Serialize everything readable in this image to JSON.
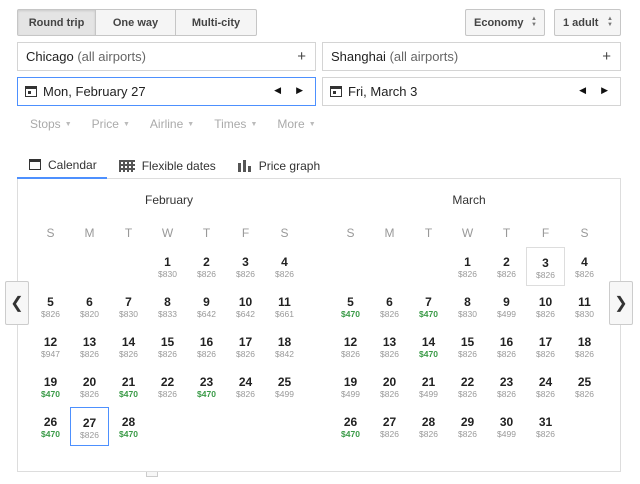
{
  "trip_type": {
    "options": [
      {
        "label": "Round trip",
        "active": true
      },
      {
        "label": "One way",
        "active": false
      },
      {
        "label": "Multi-city",
        "active": false
      }
    ]
  },
  "cabin": {
    "value": "Economy"
  },
  "passengers": {
    "value": "1 adult"
  },
  "origin": {
    "city": "Chicago",
    "qualifier": "(all airports)"
  },
  "destination": {
    "city": "Shanghai",
    "qualifier": "(all airports)"
  },
  "depart_date": {
    "value": "Mon, February 27"
  },
  "return_date": {
    "value": "Fri, March 3"
  },
  "filters": [
    "Stops",
    "Price",
    "Airline",
    "Times",
    "More"
  ],
  "view_tabs": [
    {
      "label": "Calendar",
      "icon": "calendar-icon",
      "active": true
    },
    {
      "label": "Flexible dates",
      "icon": "grid-icon",
      "active": false
    },
    {
      "label": "Price graph",
      "icon": "bar-chart-icon",
      "active": false
    }
  ],
  "weekdays": [
    "S",
    "M",
    "T",
    "W",
    "T",
    "F",
    "S"
  ],
  "colors": {
    "accent": "#4d90fe",
    "cheap": "#3b9b48",
    "muted": "#999999"
  },
  "months": [
    {
      "name": "February",
      "first_weekday": 3,
      "days": [
        {
          "d": "1",
          "p": "$830"
        },
        {
          "d": "2",
          "p": "$826"
        },
        {
          "d": "3",
          "p": "$826"
        },
        {
          "d": "4",
          "p": "$826"
        },
        {
          "d": "5",
          "p": "$826"
        },
        {
          "d": "6",
          "p": "$820"
        },
        {
          "d": "7",
          "p": "$830"
        },
        {
          "d": "8",
          "p": "$833"
        },
        {
          "d": "9",
          "p": "$642"
        },
        {
          "d": "10",
          "p": "$642"
        },
        {
          "d": "11",
          "p": "$661"
        },
        {
          "d": "12",
          "p": "$947"
        },
        {
          "d": "13",
          "p": "$826"
        },
        {
          "d": "14",
          "p": "$826"
        },
        {
          "d": "15",
          "p": "$826"
        },
        {
          "d": "16",
          "p": "$826"
        },
        {
          "d": "17",
          "p": "$826"
        },
        {
          "d": "18",
          "p": "$842"
        },
        {
          "d": "19",
          "p": "$470",
          "cheap": true
        },
        {
          "d": "20",
          "p": "$826"
        },
        {
          "d": "21",
          "p": "$470",
          "cheap": true
        },
        {
          "d": "22",
          "p": "$826"
        },
        {
          "d": "23",
          "p": "$470",
          "cheap": true
        },
        {
          "d": "24",
          "p": "$826"
        },
        {
          "d": "25",
          "p": "$499"
        },
        {
          "d": "26",
          "p": "$470",
          "cheap": true
        },
        {
          "d": "27",
          "p": "$826",
          "selected": true
        },
        {
          "d": "28",
          "p": "$470",
          "cheap": true
        }
      ]
    },
    {
      "name": "March",
      "first_weekday": 3,
      "days": [
        {
          "d": "1",
          "p": "$826"
        },
        {
          "d": "2",
          "p": "$826"
        },
        {
          "d": "3",
          "p": "$826",
          "return": true
        },
        {
          "d": "4",
          "p": "$826"
        },
        {
          "d": "5",
          "p": "$470",
          "cheap": true
        },
        {
          "d": "6",
          "p": "$826"
        },
        {
          "d": "7",
          "p": "$470",
          "cheap": true
        },
        {
          "d": "8",
          "p": "$830"
        },
        {
          "d": "9",
          "p": "$499"
        },
        {
          "d": "10",
          "p": "$826"
        },
        {
          "d": "11",
          "p": "$830"
        },
        {
          "d": "12",
          "p": "$826"
        },
        {
          "d": "13",
          "p": "$826"
        },
        {
          "d": "14",
          "p": "$470",
          "cheap": true
        },
        {
          "d": "15",
          "p": "$826"
        },
        {
          "d": "16",
          "p": "$826"
        },
        {
          "d": "17",
          "p": "$826"
        },
        {
          "d": "18",
          "p": "$826"
        },
        {
          "d": "19",
          "p": "$499"
        },
        {
          "d": "20",
          "p": "$826"
        },
        {
          "d": "21",
          "p": "$499"
        },
        {
          "d": "22",
          "p": "$826"
        },
        {
          "d": "23",
          "p": "$826"
        },
        {
          "d": "24",
          "p": "$826"
        },
        {
          "d": "25",
          "p": "$826"
        },
        {
          "d": "26",
          "p": "$470",
          "cheap": true
        },
        {
          "d": "27",
          "p": "$826"
        },
        {
          "d": "28",
          "p": "$826"
        },
        {
          "d": "29",
          "p": "$826"
        },
        {
          "d": "30",
          "p": "$499"
        },
        {
          "d": "31",
          "p": "$826"
        }
      ]
    }
  ]
}
